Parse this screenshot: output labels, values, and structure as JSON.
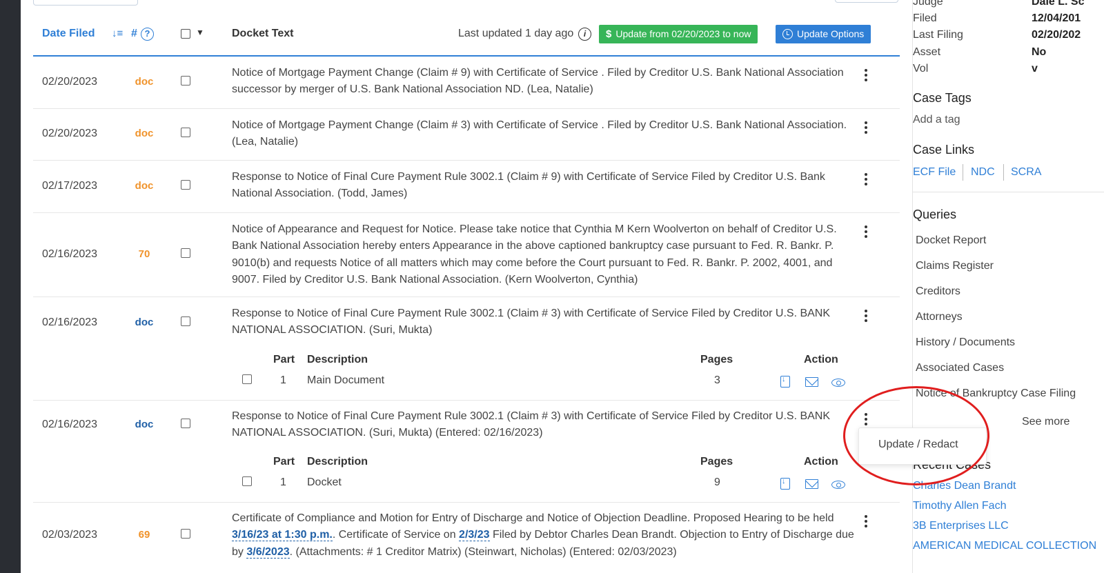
{
  "header": {
    "date_filed": "Date Filed",
    "sort_glyph": "↓≡",
    "number": "#",
    "help_glyph": "?",
    "caret_glyph": "▼",
    "docket_text": "Docket Text",
    "last_updated": "Last updated 1 day ago",
    "info_glyph": "i",
    "update_range_button": "Update from 02/20/2023 to now",
    "dollar_glyph": "$",
    "update_options_button": "Update Options"
  },
  "rows": [
    {
      "date": "02/20/2023",
      "doc": "doc",
      "text": "Notice of Mortgage Payment Change (Claim # 9) with Certificate of Service . Filed by Creditor U.S. Bank National Association successor by merger of U.S. Bank National Association ND. (Lea, Natalie)"
    },
    {
      "date": "02/20/2023",
      "doc": "doc",
      "text": "Notice of Mortgage Payment Change (Claim # 3) with Certificate of Service . Filed by Creditor U.S. Bank National Association. (Lea, Natalie)"
    },
    {
      "date": "02/17/2023",
      "doc": "doc",
      "text": "Response to Notice of Final Cure Payment Rule 3002.1 (Claim # 9) with Certificate of Service Filed by Creditor U.S. Bank National Association. (Todd, James)"
    },
    {
      "date": "02/16/2023",
      "doc": "70",
      "text": "Notice of Appearance and Request for Notice. Please take notice that Cynthia M Kern Woolverton on behalf of Creditor U.S. Bank National Association hereby enters Appearance in the above captioned bankruptcy case pursuant to Fed. R. Bankr. P. 9010(b) and requests Notice of all matters which may come before the Court pursuant to Fed. R. Bankr. P. 2002, 4001, and 9007. Filed by Creditor U.S. Bank National Association. (Kern Woolverton, Cynthia)"
    },
    {
      "date": "02/16/2023",
      "doc": "doc",
      "text": "Response to Notice of Final Cure Payment Rule 3002.1 (Claim # 3) with Certificate of Service Filed by Creditor U.S. BANK NATIONAL ASSOCIATION. (Suri, Mukta)",
      "sub": {
        "h_part": "Part",
        "h_desc": "Description",
        "h_pages": "Pages",
        "h_action": "Action",
        "part": "1",
        "description": "Main Document",
        "pages": "3"
      }
    },
    {
      "date": "02/16/2023",
      "doc": "doc",
      "text": "Response to Notice of Final Cure Payment Rule 3002.1 (Claim # 3) with Certificate of Service Filed by Creditor U.S. BANK NATIONAL ASSOCIATION. (Suri, Mukta) (Entered: 02/16/2023)",
      "sub": {
        "h_part": "Part",
        "h_desc": "Description",
        "h_pages": "Pages",
        "h_action": "Action",
        "part": "1",
        "description": "Docket",
        "pages": "9"
      }
    },
    {
      "date": "02/03/2023",
      "doc": "69",
      "text_parts": {
        "t1": "Certificate of Compliance and Motion for Entry of Discharge and Notice of Objection Deadline. Proposed Hearing to be held ",
        "link1": "3/16/23 at 1:30 p.m.",
        "t2": ". Certificate of Service on ",
        "link2": "2/3/23",
        "t3": " Filed by Debtor Charles Dean Brandt. Objection to Entry of Discharge due by ",
        "link3": "3/6/2023",
        "t4": ". (Attachments: # 1 Creditor Matrix) (Steinwart, Nicholas) (Entered: 02/03/2023)"
      }
    }
  ],
  "dropdown": {
    "item": "Update / Redact"
  },
  "sidebar": {
    "details": [
      {
        "k": "Judge",
        "v": "Dale L. Sc"
      },
      {
        "k": "Filed",
        "v": "12/04/201"
      },
      {
        "k": "Last Filing",
        "v": "02/20/202"
      },
      {
        "k": "Asset",
        "v": "No"
      },
      {
        "k": "Vol",
        "v": "v"
      }
    ],
    "case_tags_title": "Case Tags",
    "add_tag": "Add a tag",
    "case_links_title": "Case Links",
    "case_links": [
      "ECF File",
      "NDC",
      "SCRA"
    ],
    "queries_title": "Queries",
    "queries": [
      "Docket Report",
      "Claims Register",
      "Creditors",
      "Attorneys",
      "History / Documents",
      "Associated Cases",
      "Notice of Bankruptcy Case Filing"
    ],
    "see_more": "See more",
    "recent_cases_title": "Recent Cases",
    "recent_cases": [
      "Charles Dean Brandt",
      "Timothy Allen Fach",
      "3B Enterprises LLC",
      "AMERICAN MEDICAL COLLECTION"
    ]
  },
  "colors": {
    "accent_blue": "#2f7fd6",
    "update_green": "#37b558",
    "doc_orange": "#f0932b",
    "annotation_red": "#e01e1e"
  }
}
